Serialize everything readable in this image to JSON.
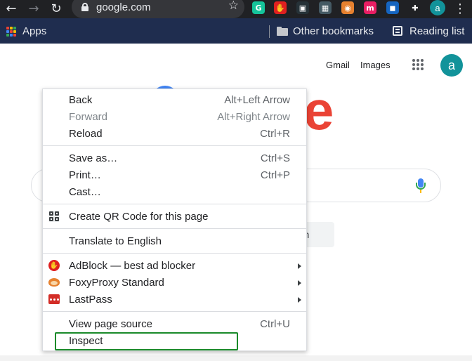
{
  "browser": {
    "url": "google.com",
    "extensions": [
      {
        "name": "grammarly-icon",
        "glyph": "G",
        "color": "#15c39a"
      },
      {
        "name": "adblock-icon",
        "glyph": "✋",
        "color": "#e02020"
      },
      {
        "name": "bookmark-ext-icon",
        "glyph": "▣",
        "color": "#263238"
      },
      {
        "name": "image-ext-icon",
        "glyph": "▦",
        "color": "#455a64"
      },
      {
        "name": "foxyproxy-icon",
        "glyph": "◉",
        "color": "#e6812f"
      },
      {
        "name": "m-ext-icon",
        "glyph": "m",
        "color": "#e91e63"
      },
      {
        "name": "screen-ext-icon",
        "glyph": "◼",
        "color": "#1565c0"
      },
      {
        "name": "puzzle-icon",
        "glyph": "✚",
        "color": "#202124"
      }
    ],
    "profile_initial": "a"
  },
  "bookmarks_bar": {
    "apps_label": "Apps",
    "other_bookmarks": "Other bookmarks",
    "reading_list": "Reading list",
    "apps_colors": [
      "#ea4335",
      "#fbbc04",
      "#34a853",
      "#4285f4",
      "#ea4335",
      "#fbbc04",
      "#34a853",
      "#4285f4",
      "#ea4335"
    ]
  },
  "google_page": {
    "gmail": "Gmail",
    "images": "Images",
    "avatar_initial": "a",
    "lucky_button": "I'm Feeling Lucky"
  },
  "context_menu": {
    "groups": [
      [
        {
          "label": "Back",
          "shortcut": "Alt+Left Arrow"
        },
        {
          "label": "Forward",
          "shortcut": "Alt+Right Arrow",
          "disabled": true
        },
        {
          "label": "Reload",
          "shortcut": "Ctrl+R"
        }
      ],
      [
        {
          "label": "Save as…",
          "shortcut": "Ctrl+S"
        },
        {
          "label": "Print…",
          "shortcut": "Ctrl+P"
        },
        {
          "label": "Cast…"
        }
      ],
      [
        {
          "label": "Create QR Code for this page",
          "icon": "qr-code-icon"
        }
      ],
      [
        {
          "label": "Translate to English"
        }
      ],
      [
        {
          "label": "AdBlock — best ad blocker",
          "icon": "adblock-icon",
          "submenu": true
        },
        {
          "label": "FoxyProxy Standard",
          "icon": "foxyproxy-icon",
          "submenu": true
        },
        {
          "label": "LastPass",
          "icon": "lastpass-icon",
          "submenu": true
        }
      ],
      [
        {
          "label": "View page source",
          "shortcut": "Ctrl+U"
        },
        {
          "label": "Inspect",
          "highlighted": true
        }
      ]
    ]
  },
  "colors": {
    "highlight": "#1a8a2a",
    "toolbar": "#202124",
    "bookmarks_bar": "#1f2d4f"
  }
}
